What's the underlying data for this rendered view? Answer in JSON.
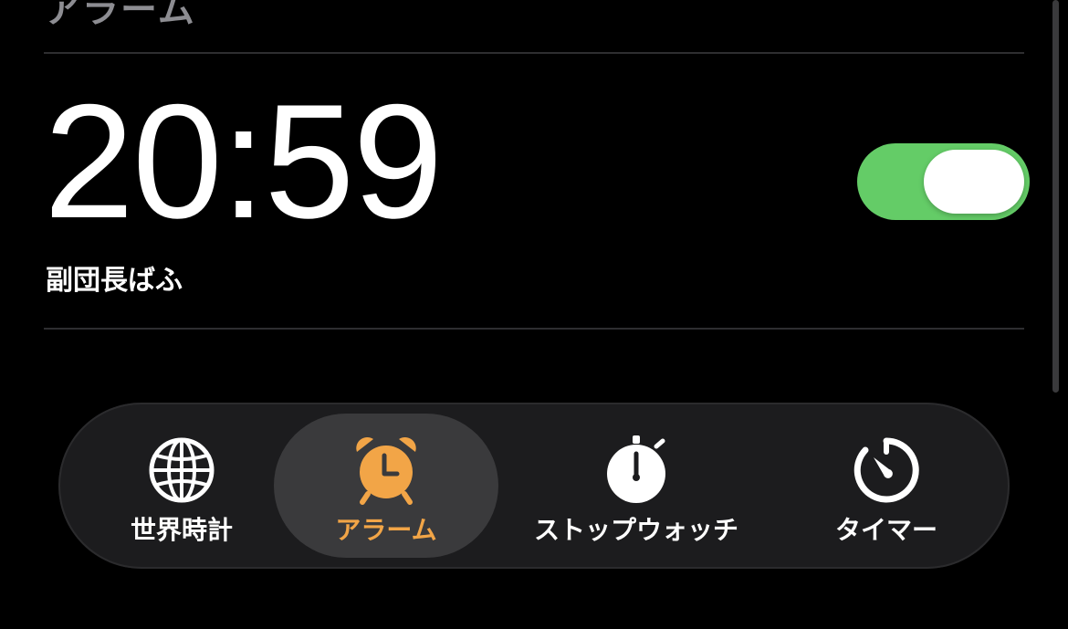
{
  "header": {
    "title": "アラーム"
  },
  "alarm": {
    "time": "20:59",
    "label": "副団長ばふ",
    "enabled": true
  },
  "tabbar": {
    "tabs": [
      {
        "label": "世界時計",
        "icon": "globe-icon"
      },
      {
        "label": "アラーム",
        "icon": "alarm-clock-icon",
        "active": true
      },
      {
        "label": "ストップウォッチ",
        "icon": "stopwatch-icon"
      },
      {
        "label": "タイマー",
        "icon": "timer-icon"
      }
    ]
  },
  "colors": {
    "background": "#000000",
    "toggle_on": "#64cc67",
    "accent": "#f2a547",
    "tabbar_bg": "#1c1c1e",
    "active_pill": "#3a3a3c"
  }
}
